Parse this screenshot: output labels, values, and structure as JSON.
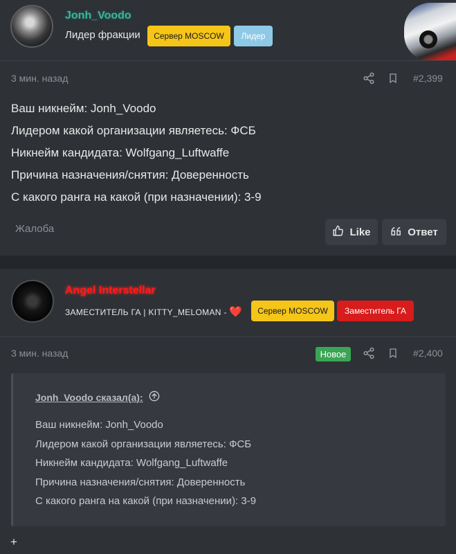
{
  "post1": {
    "username": "Jonh_Voodo",
    "title": "Лидер фракции",
    "badges": [
      "Сервер MOSCOW",
      "Лидер"
    ],
    "time": "3 мин. назад",
    "number": "#2,399",
    "lines": [
      "Ваш никнейм: Jonh_Voodo",
      "Лидером какой организации являетесь: ФСБ",
      "Никнейм кандидата: Wolfgang_Luftwaffe",
      "Причина назначения/снятия: Доверенность",
      "С какого ранга на какой (при назначении): 3-9"
    ],
    "report": "Жалоба",
    "like_label": "Like",
    "reply_label": "Ответ"
  },
  "post2": {
    "username": "Angel Interstellar",
    "title": "ЗАМЕСТИТЕЛЬ ГА | KITTY_MELOMAN -",
    "heart": "❤️",
    "badges": [
      "Сервер MOSCOW",
      "Заместитель ГА"
    ],
    "time": "3 мин. назад",
    "new_label": "Новое",
    "number": "#2,400",
    "quote": {
      "author": "Jonh_Voodo сказал(а):",
      "lines": [
        "Ваш никнейм: Jonh_Voodo",
        "Лидером какой организации являетесь: ФСБ",
        "Никнейм кандидата: Wolfgang_Luftwaffe",
        "Причина назначения/снятия: Доверенность",
        "С какого ранга на какой (при назначении): 3-9"
      ]
    },
    "plus": "+"
  },
  "icons": {
    "share": "share-icon",
    "bookmark": "bookmark-icon",
    "like": "thumbs-up-icon",
    "reply": "quote-icon",
    "expand": "arrow-up-circle-icon"
  },
  "colors": {
    "server_badge": "#f5c518",
    "leader_badge": "#8ec9e6",
    "deputy_badge": "#d81b1b",
    "new_badge": "#3aa655",
    "username1": "#3fb39b",
    "username2": "#ff1a1a"
  }
}
